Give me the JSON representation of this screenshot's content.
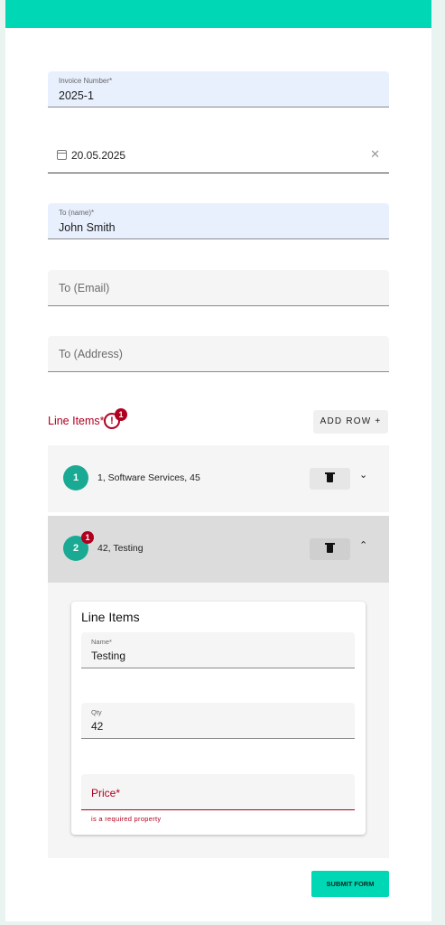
{
  "form": {
    "invoice_number": {
      "label": "Invoice Number*",
      "value": "2025-1"
    },
    "date": {
      "value": "20.05.2025",
      "clear_icon": "close-icon",
      "icon": "calendar-icon"
    },
    "to_name": {
      "label": "To (name)*",
      "value": "John Smith"
    },
    "to_email": {
      "placeholder": "To (Email)"
    },
    "to_address": {
      "placeholder": "To (Address)"
    },
    "line_items": {
      "label": "Line Items*",
      "error_icon": "!",
      "error_count": "1",
      "add_row_label": "ADD ROW +",
      "rows": [
        {
          "index": "1",
          "summary": "1, Software Services, 45",
          "chevron": "⌄"
        },
        {
          "index": "2",
          "summary": "42, Testing",
          "chevron": "⌃",
          "error_count": "1"
        }
      ],
      "editor": {
        "title": "Line Items",
        "name": {
          "label": "Name*",
          "value": "Testing"
        },
        "qty": {
          "label": "Qty",
          "value": "42"
        },
        "price": {
          "placeholder": "Price*",
          "error": "is a required property"
        }
      }
    },
    "submit_label": "SUBMIT FORM"
  },
  "colors": {
    "accent": "#00d7b4",
    "step_circle": "#1aaa94",
    "error": "#b00020",
    "filled_field": "#e8f0fe"
  }
}
